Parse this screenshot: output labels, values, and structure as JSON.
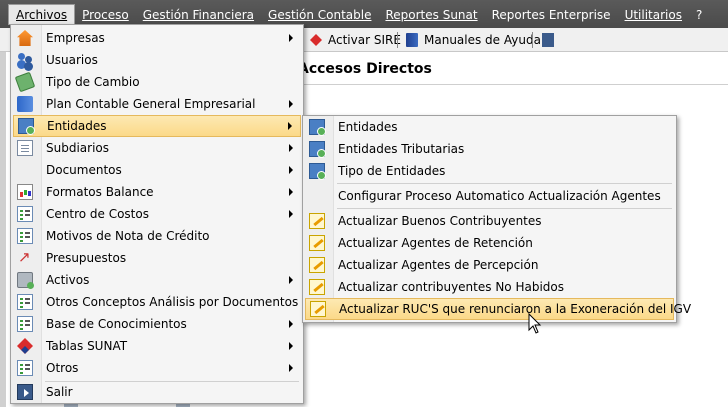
{
  "menubar": {
    "items": [
      {
        "label": "Archivos"
      },
      {
        "label": "Proceso"
      },
      {
        "label": "Gestión Financiera"
      },
      {
        "label": "Gestión Contable"
      },
      {
        "label": "Reportes Sunat"
      },
      {
        "label": "Reportes Enterprise"
      },
      {
        "label": "Utilitarios"
      },
      {
        "label": "?"
      }
    ]
  },
  "toolbar": {
    "sire_label": "Activar SIRE",
    "manuals_label": "Manuales de Ayuda"
  },
  "content": {
    "section_title": "Accesos Directos"
  },
  "archivos_menu": {
    "items": [
      {
        "label": "Empresas",
        "icon": "house-icon",
        "submenu": true
      },
      {
        "label": "Usuarios",
        "icon": "users-icon",
        "submenu": false
      },
      {
        "label": "Tipo de Cambio",
        "icon": "money-icon",
        "submenu": false
      },
      {
        "label": "Plan Contable General Empresarial",
        "icon": "book-icon",
        "submenu": true
      },
      {
        "label": "Entidades",
        "icon": "entity-icon",
        "submenu": true,
        "highlighted": true
      },
      {
        "label": "Subdiarios",
        "icon": "document-icon",
        "submenu": true
      },
      {
        "label": "Documentos",
        "icon": "document-icon",
        "submenu": true
      },
      {
        "label": "Formatos Balance",
        "icon": "chart-icon",
        "submenu": true
      },
      {
        "label": "Centro de Costos",
        "icon": "list-icon",
        "submenu": true
      },
      {
        "label": "Motivos de Nota de Crédito",
        "icon": "list-icon",
        "submenu": false
      },
      {
        "label": "Presupuestos",
        "icon": "graph-icon",
        "submenu": false
      },
      {
        "label": "Activos",
        "icon": "assets-icon",
        "submenu": true
      },
      {
        "label": "Otros Conceptos Análisis por Documentos",
        "icon": "list-icon",
        "submenu": false
      },
      {
        "label": "Base de Conocimientos",
        "icon": "list-icon",
        "submenu": true
      },
      {
        "label": "Tablas SUNAT",
        "icon": "sunat-icon",
        "submenu": true
      },
      {
        "label": "Otros",
        "icon": "list-icon",
        "submenu": true
      },
      {
        "label": "Salir",
        "icon": "exit-icon",
        "submenu": false
      }
    ]
  },
  "entidades_submenu": {
    "items": [
      {
        "label": "Entidades",
        "icon": "entity-icon"
      },
      {
        "label": "Entidades Tributarias",
        "icon": "entity-icon"
      },
      {
        "label": "Tipo de Entidades",
        "icon": "entity-icon"
      },
      {
        "label": "Configurar Proceso Automatico Actualización Agentes",
        "icon": "none"
      },
      {
        "label": "Actualizar Buenos Contribuyentes",
        "icon": "pencil-icon"
      },
      {
        "label": "Actualizar Agentes de Retención",
        "icon": "pencil-icon"
      },
      {
        "label": "Actualizar Agentes de Percepción",
        "icon": "pencil-icon"
      },
      {
        "label": "Actualizar contribuyentes No Habidos",
        "icon": "pencil-icon"
      },
      {
        "label": "Actualizar RUC'S que renunciaron a la Exoneración del IGV",
        "icon": "pencil-icon",
        "highlighted": true
      }
    ]
  }
}
